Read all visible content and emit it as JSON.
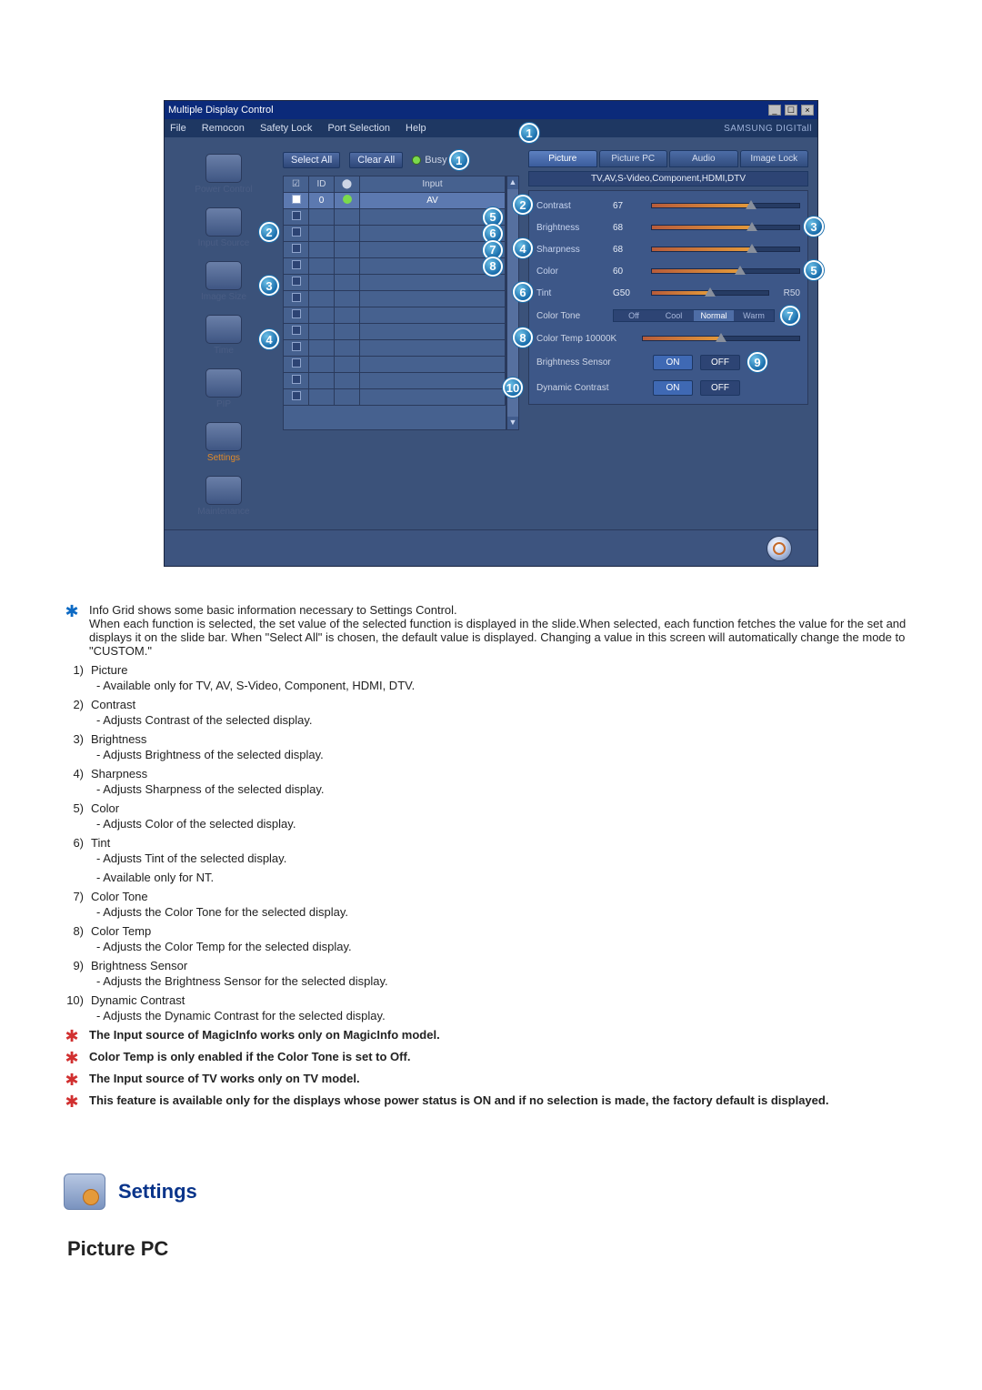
{
  "window": {
    "title": "Multiple Display Control",
    "menus": [
      "File",
      "Remocon",
      "Safety Lock",
      "Port Selection",
      "Help"
    ],
    "brand": "SAMSUNG DIGITall"
  },
  "toolbar": {
    "select_all": "Select All",
    "clear_all": "Clear All",
    "busy": "Busy"
  },
  "grid_head": {
    "c1": "☑",
    "c2": "ID",
    "c3": "",
    "c4": "Input"
  },
  "grid_rows": [
    {
      "checked": true,
      "id": "0",
      "status": "on",
      "input": "AV"
    },
    {
      "checked": false,
      "id": "",
      "status": "",
      "input": ""
    },
    {
      "checked": false,
      "id": "",
      "status": "",
      "input": ""
    },
    {
      "checked": false,
      "id": "",
      "status": "",
      "input": ""
    },
    {
      "checked": false,
      "id": "",
      "status": "",
      "input": ""
    },
    {
      "checked": false,
      "id": "",
      "status": "",
      "input": ""
    },
    {
      "checked": false,
      "id": "",
      "status": "",
      "input": ""
    },
    {
      "checked": false,
      "id": "",
      "status": "",
      "input": ""
    },
    {
      "checked": false,
      "id": "",
      "status": "",
      "input": ""
    },
    {
      "checked": false,
      "id": "",
      "status": "",
      "input": ""
    },
    {
      "checked": false,
      "id": "",
      "status": "",
      "input": ""
    },
    {
      "checked": false,
      "id": "",
      "status": "",
      "input": ""
    },
    {
      "checked": false,
      "id": "",
      "status": "",
      "input": ""
    }
  ],
  "sidebar": [
    {
      "label": "Power Control"
    },
    {
      "label": "Input Source"
    },
    {
      "label": "Image Size"
    },
    {
      "label": "Time"
    },
    {
      "label": "PIP"
    },
    {
      "label": "Settings",
      "active": true
    },
    {
      "label": "Maintenance"
    }
  ],
  "tabs": [
    "Picture",
    "Picture PC",
    "Audio",
    "Image Lock"
  ],
  "active_tab_index": 0,
  "context_strip": "TV,AV,S-Video,Component,HDMI,DTV",
  "sliders": {
    "contrast": {
      "label": "Contrast",
      "value": 67
    },
    "brightness": {
      "label": "Brightness",
      "value": 68
    },
    "sharpness": {
      "label": "Sharpness",
      "value": 68
    },
    "color": {
      "label": "Color",
      "value": 60
    },
    "tint": {
      "label": "Tint",
      "left": "G50",
      "right": "R50",
      "value": 50
    }
  },
  "color_tone": {
    "label": "Color Tone",
    "options": [
      "Off",
      "Cool",
      "Normal",
      "Warm"
    ],
    "selected": 2
  },
  "color_temp": {
    "label": "Color Temp 10000K",
    "value": 50
  },
  "brightness_sensor": {
    "label": "Brightness Sensor",
    "on": "ON",
    "off": "OFF"
  },
  "dynamic_contrast": {
    "label": "Dynamic Contrast",
    "on": "ON",
    "off": "OFF"
  },
  "callouts_top": "1",
  "callouts_sidebar": {
    "s2": "2",
    "s3": "3",
    "s4": "4"
  },
  "callouts_center": {
    "c5": "5",
    "c6": "6",
    "c7": "7",
    "c8": "8"
  },
  "callouts_right": {
    "r2": "2",
    "r3": "3",
    "r4": "4",
    "r5": "5",
    "r6": "6",
    "r7": "7",
    "r8": "8",
    "r9": "9",
    "r10": "10"
  },
  "desc": {
    "intro": "Info Grid shows some basic information necessary to Settings Control.",
    "intro2": "When each function is selected, the set value of the selected function is displayed in the slide.When selected, each function fetches the value for the set and displays it on the slide bar. When \"Select All\" is chosen, the default value is displayed. Changing a value in this screen will automatically change the mode to \"CUSTOM.\"",
    "items": [
      {
        "n": "1)",
        "t": "Picture",
        "subs": [
          "- Available only for TV, AV, S-Video, Component, HDMI, DTV."
        ]
      },
      {
        "n": "2)",
        "t": "Contrast",
        "subs": [
          "- Adjusts Contrast of the selected display."
        ]
      },
      {
        "n": "3)",
        "t": "Brightness",
        "subs": [
          "- Adjusts Brightness of the selected display."
        ]
      },
      {
        "n": "4)",
        "t": "Sharpness",
        "subs": [
          "- Adjusts Sharpness of the selected display."
        ]
      },
      {
        "n": "5)",
        "t": "Color",
        "subs": [
          "- Adjusts Color of the selected display."
        ]
      },
      {
        "n": "6)",
        "t": "Tint",
        "subs": [
          "- Adjusts Tint of the selected display.",
          "- Available  only for NT."
        ]
      },
      {
        "n": "7)",
        "t": "Color Tone",
        "subs": [
          "- Adjusts the Color Tone for the selected display."
        ]
      },
      {
        "n": "8)",
        "t": "Color Temp",
        "subs": [
          "- Adjusts the Color Temp for the selected display."
        ]
      },
      {
        "n": "9)",
        "t": "Brightness Sensor",
        "subs": [
          "- Adjusts the Brightness Sensor for the selected display."
        ]
      },
      {
        "n": "10)",
        "t": "Dynamic Contrast",
        "subs": [
          "- Adjusts the Dynamic Contrast for the selected display."
        ]
      }
    ],
    "notes": [
      "The Input source of MagicInfo works only on MagicInfo model.",
      "Color Temp is only enabled if the Color Tone is set to Off.",
      "The Input source of TV works only on TV model.",
      "This feature is available only for the displays whose power status is ON and if no selection is made, the factory default is displayed."
    ]
  },
  "section_title": "Settings",
  "page_subtitle": "Picture PC"
}
